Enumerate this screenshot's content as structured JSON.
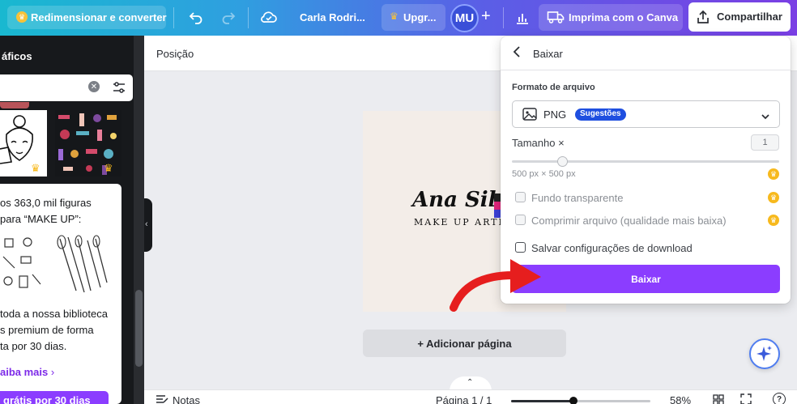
{
  "topbar": {
    "resize_label": "Redimensionar e converter",
    "doc_title": "Carla Rodri...",
    "upgrade_label": "Upgr...",
    "avatar_initials": "MU",
    "print_label": "Imprima com o Canva",
    "share_label": "Compartilhar"
  },
  "left_panel": {
    "heading": "áficos",
    "promo_lines": [
      "os 363,0 mil figuras",
      "para “MAKE UP”:"
    ],
    "promo_body": [
      "toda a nossa biblioteca",
      "s premium de forma",
      "ta por 30 dias."
    ],
    "learn_more": "aiba mais",
    "cta": "grátis por 30 dias"
  },
  "subbar": {
    "position_label": "Posição"
  },
  "canvas": {
    "logo_script": "Ana Silva",
    "logo_sub": "MAKE UP ARTI",
    "add_page": "+ Adicionar página"
  },
  "bottombar": {
    "notes_label": "Notas",
    "page_indicator": "Página 1 / 1",
    "zoom_label": "58%",
    "zoom_fraction": 0.45
  },
  "download": {
    "title": "Baixar",
    "format_label": "Formato de arquivo",
    "format_value": "PNG",
    "format_badge": "Sugestões",
    "size_label": "Tamanho ×",
    "size_value": "1",
    "size_hint": "500 px × 500 px",
    "transparent_label": "Fundo transparente",
    "compress_label": "Comprimir arquivo (qualidade mais baixa)",
    "save_settings_label": "Salvar configurações de download",
    "download_button": "Baixar"
  },
  "colors": {
    "accent_purple": "#8b3dff",
    "badge_blue": "#1f4fe0",
    "crown_gold": "#f7b91d",
    "arrow_red": "#e61e1e"
  }
}
